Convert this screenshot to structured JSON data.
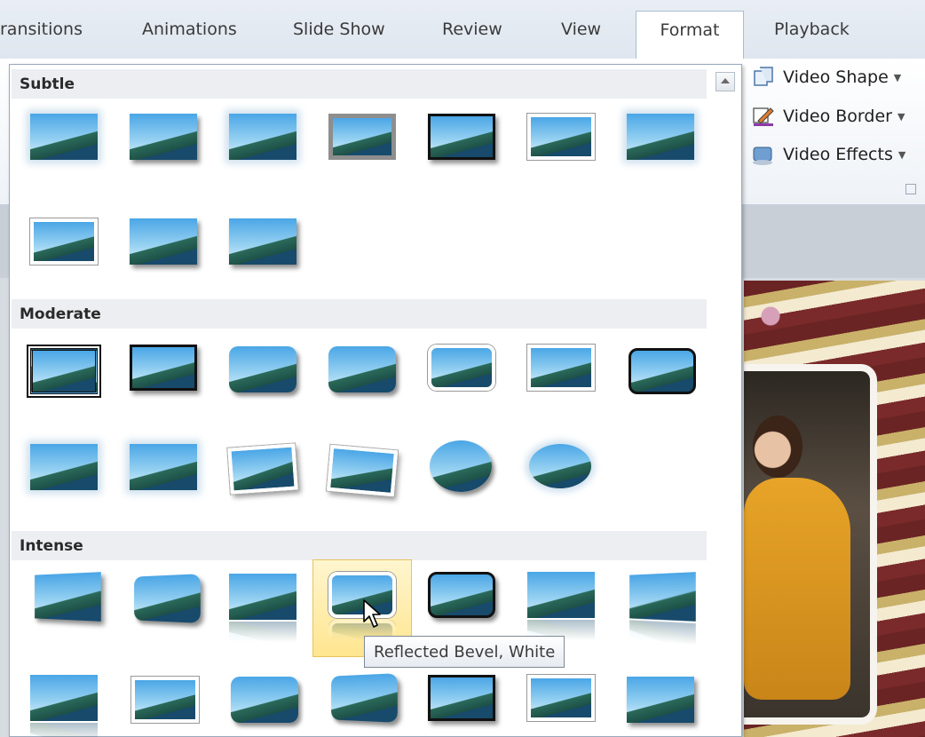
{
  "ribbon_tabs": [
    "ransitions",
    "Animations",
    "Slide Show",
    "Review",
    "View",
    "Format",
    "Playback"
  ],
  "active_tab": "Format",
  "commands": {
    "video_shape": "Video Shape",
    "video_border": "Video Border",
    "video_effects": "Video Effects"
  },
  "gallery": {
    "sections": [
      "Subtle",
      "Moderate",
      "Intense"
    ],
    "hovered_style": "Reflected Bevel, White"
  },
  "tooltip": "Reflected Bevel, White",
  "colors": {
    "hover_fill": "#ffe58e",
    "tab_border": "#a9bdd6"
  }
}
